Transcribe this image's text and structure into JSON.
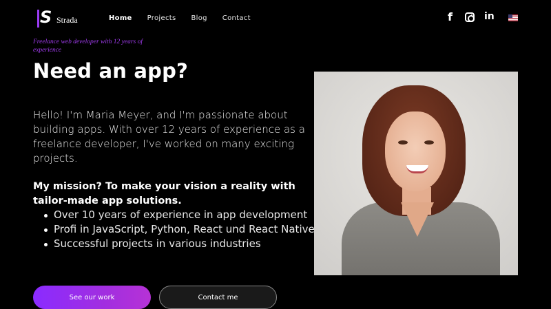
{
  "brand": {
    "name": "Strada",
    "logo_letter": "S",
    "accent": "#9b3cf5"
  },
  "nav": {
    "items": [
      {
        "label": "Home",
        "active": true
      },
      {
        "label": "Projects",
        "active": false
      },
      {
        "label": "Blog",
        "active": false
      },
      {
        "label": "Contact",
        "active": false
      }
    ]
  },
  "social": {
    "facebook_glyph": "f",
    "linkedin_glyph": "in",
    "icons": [
      "facebook-icon",
      "instagram-icon",
      "linkedin-icon",
      "us-flag-icon"
    ]
  },
  "hero": {
    "tagline": "Freelance web developer with 12 years of experience",
    "headline": "Need an app?",
    "intro": "Hello! I'm Maria Meyer, and I'm passionate about building apps. With over 12 years of experience as a freelance developer, I've worked on many exciting projects.",
    "mission": "My mission? To make your vision a reality with tailor-made app solutions.",
    "points": [
      "Over 10 years of experience in app development",
      "Profi in JavaScript, Python, React und React Native",
      "Successful projects in various industries"
    ]
  },
  "buttons": {
    "primary_label": "See our work",
    "secondary_label": "Contact me"
  }
}
